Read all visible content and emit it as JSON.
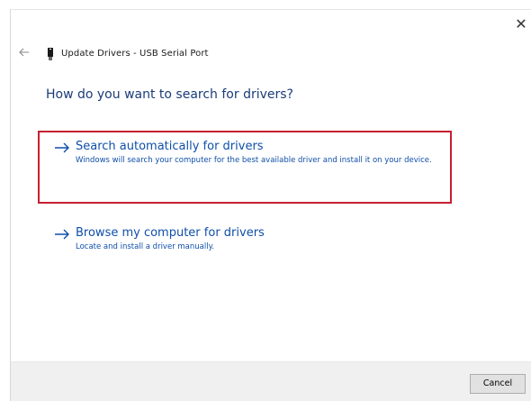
{
  "window": {
    "title": "Update Drivers - USB Serial Port",
    "close_glyph": "✕"
  },
  "heading": "How do you want to search for drivers?",
  "options": [
    {
      "title": "Search automatically for drivers",
      "description": "Windows will search your computer for the best available driver and install it on your device.",
      "highlighted": true
    },
    {
      "title": "Browse my computer for drivers",
      "description": "Locate and install a driver manually.",
      "highlighted": false
    }
  ],
  "footer": {
    "cancel_label": "Cancel"
  },
  "icons": {
    "back": "back-arrow-icon",
    "device": "usb-device-icon",
    "option_arrow": "right-arrow-icon",
    "close": "close-icon"
  },
  "colors": {
    "link_blue": "#0f4fa8",
    "heading_blue": "#1a3c7a",
    "highlight_red": "#c62030",
    "footer_bg": "#f0f0f0"
  }
}
